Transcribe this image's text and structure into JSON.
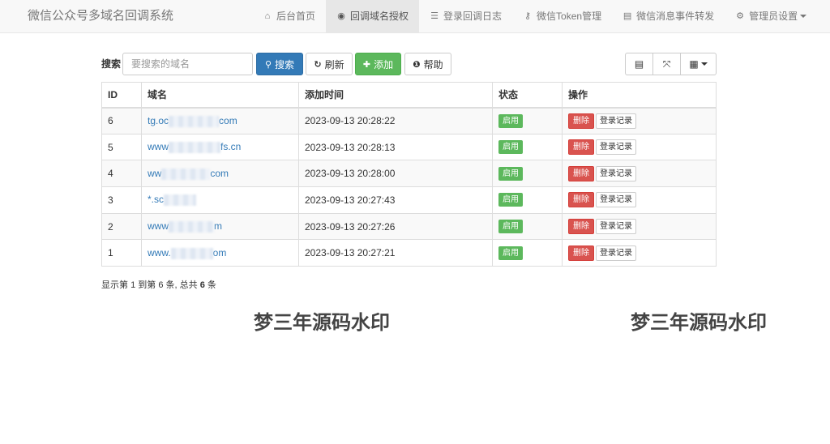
{
  "navbar": {
    "brand": "微信公众号多域名回调系统",
    "items": [
      {
        "icon": "home-icon",
        "glyph": "⌂",
        "label": "后台首页",
        "active": false
      },
      {
        "icon": "globe-icon",
        "glyph": "◉",
        "label": "回调域名授权",
        "active": true
      },
      {
        "icon": "list-icon",
        "glyph": "☰",
        "label": "登录回调日志",
        "active": false
      },
      {
        "icon": "key-icon",
        "glyph": "⚷",
        "label": "微信Token管理",
        "active": false
      },
      {
        "icon": "list-alt-icon",
        "glyph": "▤",
        "label": "微信消息事件转发",
        "active": false
      },
      {
        "icon": "gear-icon",
        "glyph": "⚙",
        "label": "管理员设置",
        "active": false
      }
    ]
  },
  "toolbar": {
    "search_label": "搜索",
    "search_placeholder": "要搜索的域名",
    "search_value": "",
    "search_button": "搜索",
    "refresh_button": "刷新",
    "add_button": "添加",
    "help_button": "帮助"
  },
  "table": {
    "headers": [
      "ID",
      "域名",
      "添加时间",
      "状态",
      "操作"
    ],
    "rows": [
      {
        "id": "6",
        "domain_prefix": "tg.oc",
        "domain_suffix": "com",
        "time": "2023-09-13 20:28:22",
        "status": "启用"
      },
      {
        "id": "5",
        "domain_prefix": "www",
        "domain_suffix": "fs.cn",
        "time": "2023-09-13 20:28:13",
        "status": "启用"
      },
      {
        "id": "4",
        "domain_prefix": "ww",
        "domain_suffix": "com",
        "time": "2023-09-13 20:28:00",
        "status": "启用"
      },
      {
        "id": "3",
        "domain_prefix": "*.sc",
        "domain_suffix": "",
        "time": "2023-09-13 20:27:43",
        "status": "启用"
      },
      {
        "id": "2",
        "domain_prefix": "www",
        "domain_suffix": "m",
        "time": "2023-09-13 20:27:26",
        "status": "启用"
      },
      {
        "id": "1",
        "domain_prefix": "www.",
        "domain_suffix": "om",
        "time": "2023-09-13 20:27:21",
        "status": "启用"
      }
    ],
    "delete_label": "删除",
    "log_label": "登录记录"
  },
  "summary": {
    "prefix": "显示第",
    "from": "1",
    "mid1": "到第",
    "to": "6",
    "mid2": "条, 总共",
    "total": "6",
    "suffix": "条"
  },
  "watermark": "梦三年源码水印"
}
